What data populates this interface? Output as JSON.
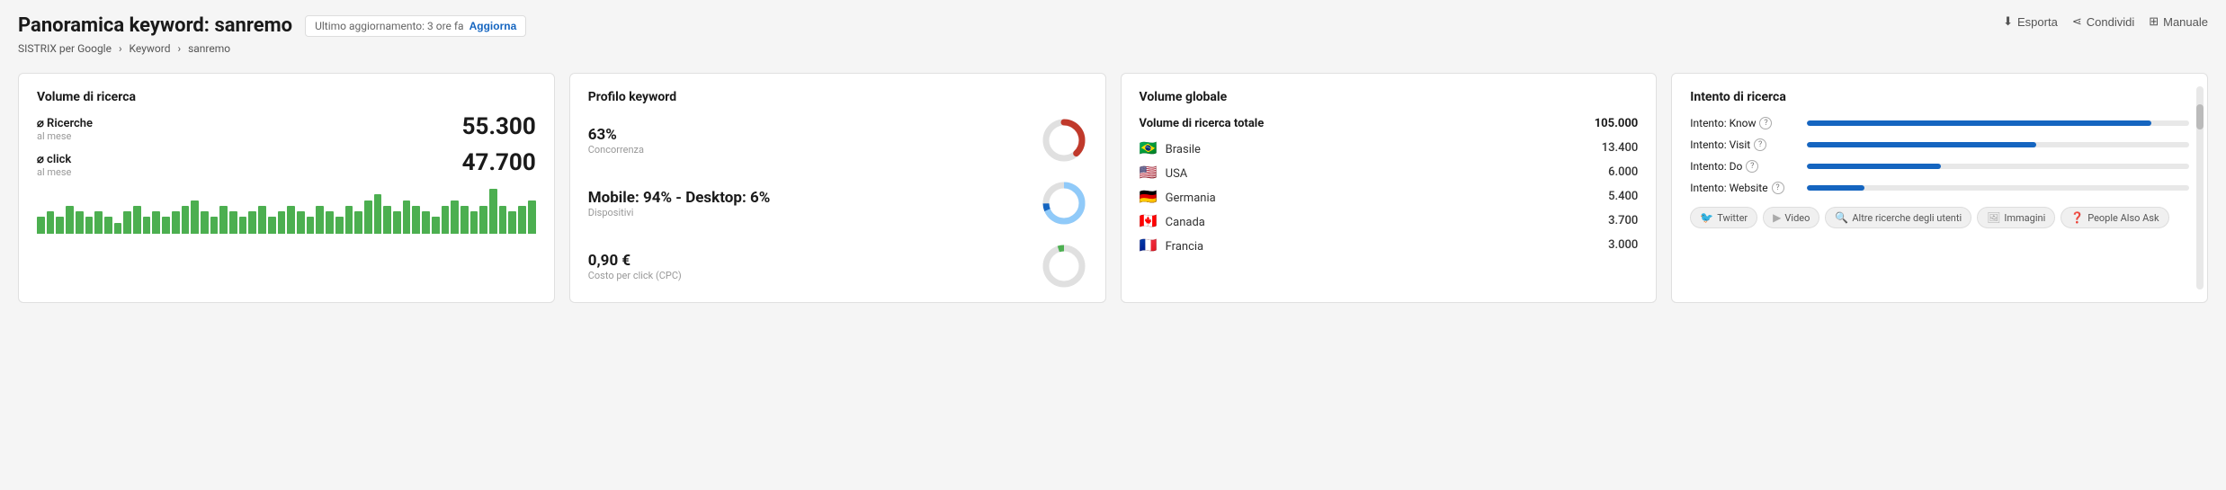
{
  "header": {
    "title": "Panoramica keyword: sanremo",
    "update_text": "Ultimo aggiornamento: 3 ore fa",
    "update_btn": "Aggiorna",
    "breadcrumb": [
      "SISTRIX per Google",
      "Keyword",
      "sanremo"
    ]
  },
  "toolbar": {
    "esporta": "Esporta",
    "condividi": "Condividi",
    "manuale": "Manuale"
  },
  "volume_ricerca": {
    "title": "Volume di ricerca",
    "ricerche_label": "⌀ Ricerche",
    "ricerche_sub": "al mese",
    "ricerche_val": "55.300",
    "click_label": "⌀ click",
    "click_sub": "al mese",
    "click_val": "47.700",
    "bars": [
      3,
      4,
      3,
      5,
      4,
      3,
      4,
      3,
      2,
      4,
      5,
      3,
      4,
      3,
      4,
      5,
      6,
      4,
      3,
      5,
      4,
      3,
      4,
      5,
      3,
      4,
      5,
      4,
      3,
      5,
      4,
      3,
      5,
      4,
      6,
      7,
      5,
      4,
      6,
      5,
      4,
      3,
      5,
      6,
      5,
      4,
      5,
      8,
      5,
      4,
      5,
      6
    ]
  },
  "profilo_keyword": {
    "title": "Profilo keyword",
    "concorrenza_pct": "63%",
    "concorrenza_label": "Concorrenza",
    "dispositivi_pct": "Mobile: 94% - Desktop: 6%",
    "dispositivi_label": "Dispositivi",
    "cpc_val": "0,90 €",
    "cpc_label": "Costo per click (CPC)"
  },
  "volume_globale": {
    "title": "Volume globale",
    "total_label": "Volume di ricerca totale",
    "total_val": "105.000",
    "countries": [
      {
        "flag": "🇧🇷",
        "name": "Brasile",
        "val": "13.400"
      },
      {
        "flag": "🇺🇸",
        "name": "USA",
        "val": "6.000"
      },
      {
        "flag": "🇩🇪",
        "name": "Germania",
        "val": "5.400"
      },
      {
        "flag": "🇨🇦",
        "name": "Canada",
        "val": "3.700"
      },
      {
        "flag": "🇫🇷",
        "name": "Francia",
        "val": "3.000"
      }
    ]
  },
  "intento_ricerca": {
    "title": "Intento di ricerca",
    "intents": [
      {
        "label": "Intento: Know",
        "pct": 90
      },
      {
        "label": "Intento: Visit",
        "pct": 60
      },
      {
        "label": "Intento: Do",
        "pct": 35
      },
      {
        "label": "Intento: Website",
        "pct": 15
      }
    ],
    "tags": [
      {
        "icon": "🐦",
        "label": "Twitter"
      },
      {
        "icon": "▶",
        "label": "Video"
      },
      {
        "icon": "🔍",
        "label": "Altre ricerche degli utenti"
      },
      {
        "icon": "🖼",
        "label": "Immagini"
      },
      {
        "icon": "❓",
        "label": "People Also Ask"
      }
    ]
  }
}
